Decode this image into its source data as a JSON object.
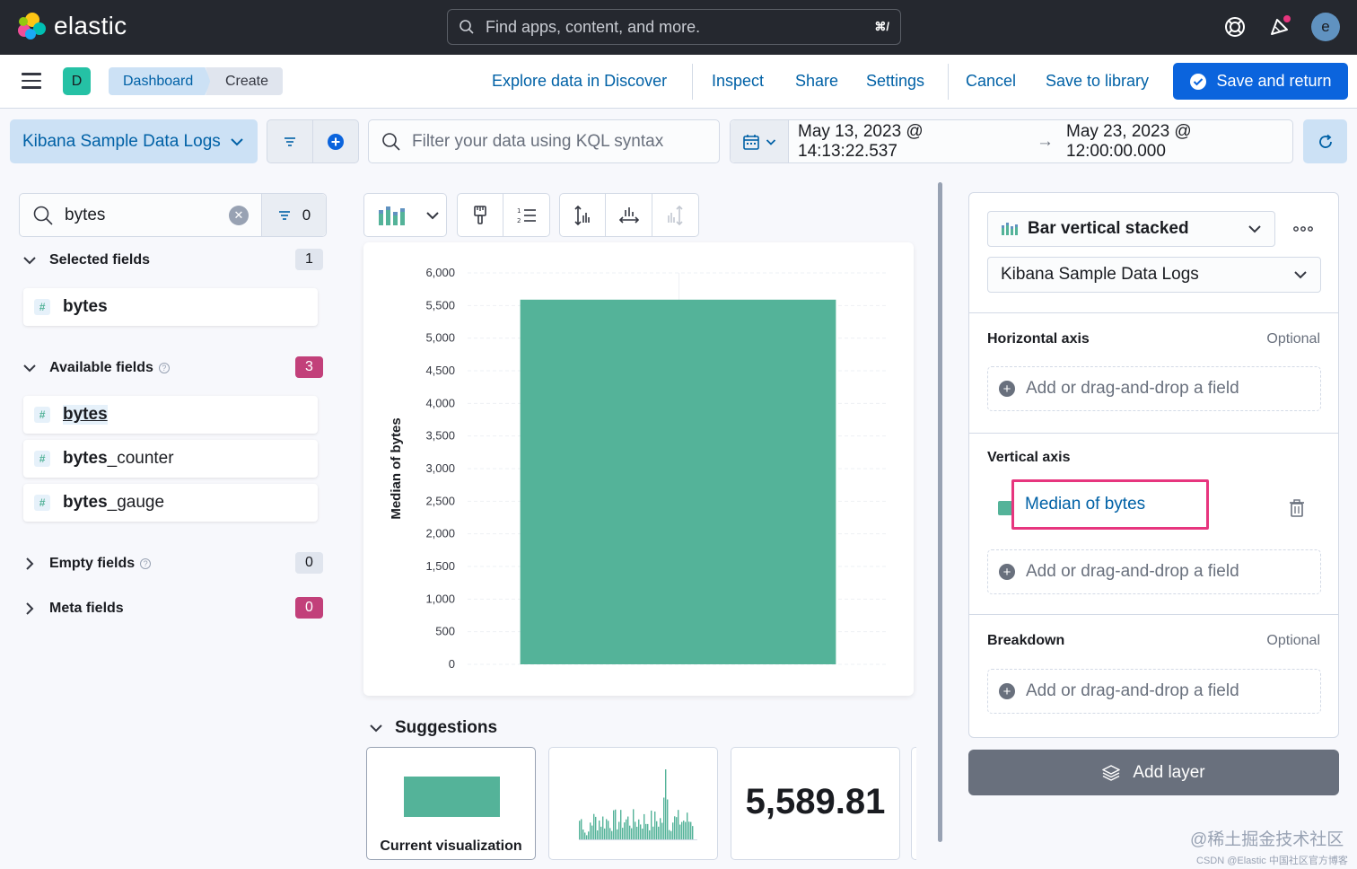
{
  "header": {
    "logo_text": "elastic",
    "search_placeholder": "Find apps, content, and more.",
    "search_shortcut": "⌘/",
    "avatar_letter": "e"
  },
  "nav": {
    "space_letter": "D",
    "breadcrumbs": [
      "Dashboard",
      "Create"
    ],
    "links": {
      "explore": "Explore data in Discover",
      "inspect": "Inspect",
      "share": "Share",
      "settings": "Settings",
      "cancel": "Cancel",
      "save_library": "Save to library",
      "save_return": "Save and return"
    }
  },
  "query_bar": {
    "data_view": "Kibana Sample Data Logs",
    "kql_placeholder": "Filter your data using KQL syntax",
    "date_start": "May 13, 2023 @ 14:13:22.537",
    "date_arrow": "→",
    "date_end": "May 23, 2023 @ 12:00:00.000"
  },
  "field_list": {
    "search_value": "bytes",
    "filter_count": "0",
    "selected": {
      "label": "Selected fields",
      "count": "1",
      "fields": [
        {
          "match": "bytes",
          "rest": ""
        }
      ]
    },
    "available": {
      "label": "Available fields",
      "count": "3",
      "fields": [
        {
          "match": "bytes",
          "rest": ""
        },
        {
          "match": "bytes",
          "rest": "_counter"
        },
        {
          "match": "bytes",
          "rest": "_gauge"
        }
      ]
    },
    "empty": {
      "label": "Empty fields",
      "count": "0"
    },
    "meta": {
      "label": "Meta fields",
      "count": "0"
    }
  },
  "chart_data": {
    "type": "bar",
    "categories": [
      ""
    ],
    "values": [
      5589.81
    ],
    "title": "",
    "xlabel": "",
    "ylabel": "Median of bytes",
    "ylim": [
      0,
      6000
    ],
    "yticks": [
      "0",
      "500",
      "1,000",
      "1,500",
      "2,000",
      "2,500",
      "3,000",
      "3,500",
      "4,000",
      "4,500",
      "5,000",
      "5,500",
      "6,000"
    ],
    "ytick_values": [
      0,
      500,
      1000,
      1500,
      2000,
      2500,
      3000,
      3500,
      4000,
      4500,
      5000,
      5500,
      6000
    ],
    "grid": true,
    "color": "#54b399"
  },
  "suggestions": {
    "title": "Suggestions",
    "cards": [
      {
        "label": "Current visualization"
      },
      {
        "label": ""
      },
      {
        "metric": "5,589.81"
      }
    ]
  },
  "config": {
    "chart_type": "Bar vertical stacked",
    "data_view": "Kibana Sample Data Logs",
    "horizontal": {
      "label": "Horizontal axis",
      "optional": "Optional",
      "placeholder": "Add or drag-and-drop a field"
    },
    "vertical": {
      "label": "Vertical axis",
      "dimension": "Median of bytes",
      "placeholder": "Add or drag-and-drop a field"
    },
    "breakdown": {
      "label": "Breakdown",
      "optional": "Optional",
      "placeholder": "Add or drag-and-drop a field"
    },
    "add_layer": "Add layer"
  },
  "watermark": {
    "main": "@稀土掘金技术社区",
    "sub": "CSDN @Elastic 中国社区官方博客"
  },
  "colors": {
    "accent": "#0b64dd",
    "bar": "#54b399",
    "highlight": "#e7357e",
    "pink_badge": "#c2407a"
  }
}
